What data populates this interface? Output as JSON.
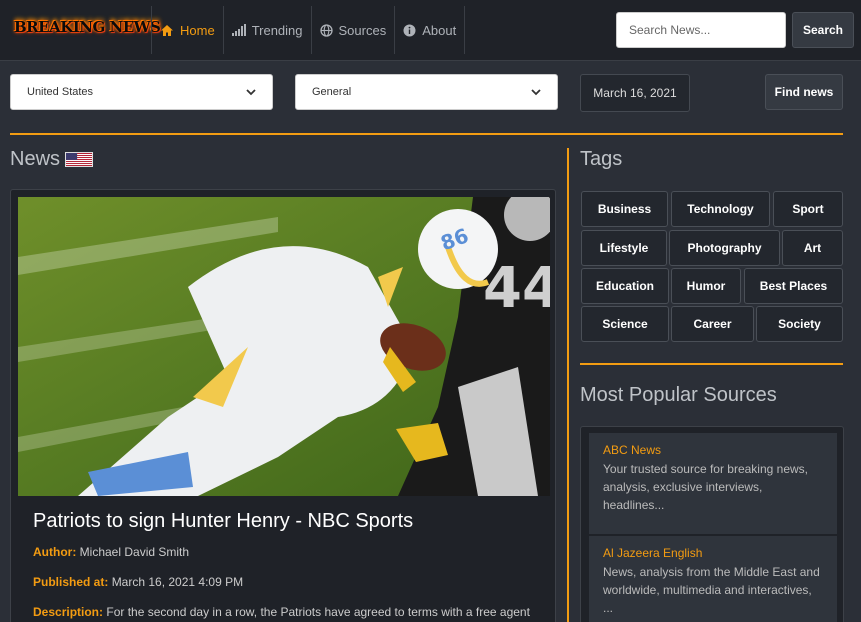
{
  "brand": {
    "logo_text": "BREAKING NEWS"
  },
  "nav": {
    "items": [
      {
        "label": "Home",
        "icon": "home-icon"
      },
      {
        "label": "Trending",
        "icon": "signal-bars-icon"
      },
      {
        "label": "Sources",
        "icon": "globe-icon"
      },
      {
        "label": "About",
        "icon": "info-circle-icon"
      }
    ],
    "active": "Home"
  },
  "search": {
    "placeholder": "Search News...",
    "button_label": "Search"
  },
  "filters": {
    "country": "United States",
    "category": "General",
    "date": "March 16, 2021",
    "find_label": "Find news"
  },
  "news": {
    "section_title": "News",
    "article": {
      "image_icon": "football-photo",
      "title": "Patriots to sign Hunter Henry - NBC Sports",
      "author_label": "Author:",
      "author": "Michael David Smith",
      "published_label": "Published at:",
      "published": "March 16, 2021 4:09 PM",
      "description_label": "Description:",
      "description": "For the second day in a row, the Patriots have agreed to terms with a free agent"
    }
  },
  "tags": {
    "title": "Tags",
    "items": [
      "Business",
      "Technology",
      "Sport",
      "Lifestyle",
      "Photography",
      "Art",
      "Education",
      "Humor",
      "Best Places",
      "Science",
      "Career",
      "Society"
    ]
  },
  "sources": {
    "title": "Most Popular Sources",
    "items": [
      {
        "name": "ABC News",
        "description": "Your trusted source for breaking news, analysis, exclusive interviews, headlines..."
      },
      {
        "name": "Al Jazeera English",
        "description": "News, analysis from the Middle East and worldwide, multimedia and interactives, ..."
      }
    ]
  },
  "colors": {
    "accent": "#f39c12",
    "background": "#2b2f37",
    "navbar": "#1f2228"
  }
}
